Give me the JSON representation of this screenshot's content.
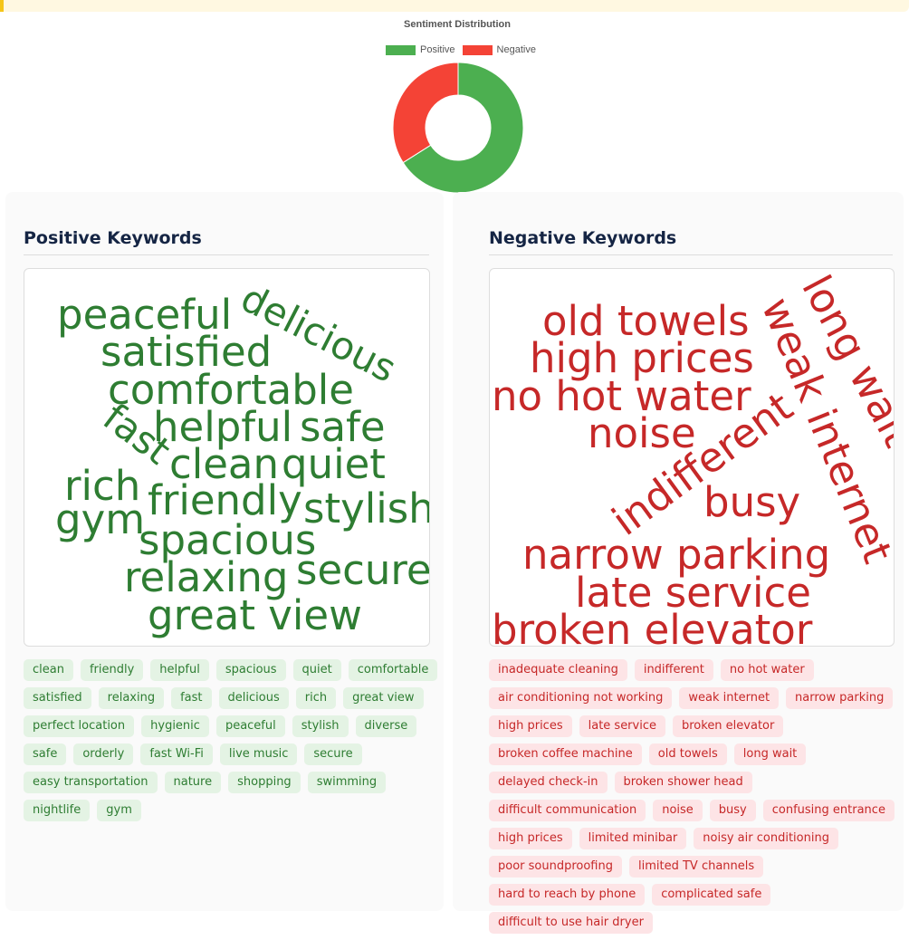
{
  "chart_data": {
    "type": "pie",
    "title": "Sentiment Distribution",
    "legend_position": "top",
    "categories": [
      "Positive",
      "Negative"
    ],
    "values": [
      66,
      34
    ],
    "colors": [
      "#4caf50",
      "#f44336"
    ]
  },
  "positive": {
    "title": "Positive Keywords",
    "color": "#2e7d32",
    "cloud": [
      "peaceful",
      "delicious",
      "satisfied",
      "comfortable",
      "helpful",
      "safe",
      "fast",
      "clean",
      "quiet",
      "rich",
      "friendly",
      "stylish",
      "gym",
      "spacious",
      "relaxing",
      "secure",
      "great view"
    ],
    "tags": [
      "clean",
      "friendly",
      "helpful",
      "spacious",
      "quiet",
      "comfortable",
      "satisfied",
      "relaxing",
      "fast",
      "delicious",
      "rich",
      "great view",
      "perfect location",
      "hygienic",
      "peaceful",
      "stylish",
      "diverse",
      "safe",
      "orderly",
      "fast Wi-Fi",
      "live music",
      "secure",
      "easy transportation",
      "nature",
      "shopping",
      "swimming",
      "nightlife",
      "gym"
    ]
  },
  "negative": {
    "title": "Negative Keywords",
    "color": "#c62828",
    "cloud": [
      "old towels",
      "long wait",
      "weak internet",
      "high prices",
      "no hot water",
      "noise",
      "indifferent",
      "busy",
      "narrow parking",
      "late service",
      "broken elevator"
    ],
    "tags": [
      "inadequate cleaning",
      "indifferent",
      "no hot water",
      "air conditioning not working",
      "weak internet",
      "narrow parking",
      "high prices",
      "late service",
      "broken elevator",
      "broken coffee machine",
      "old towels",
      "long wait",
      "delayed check-in",
      "broken shower head",
      "difficult communication",
      "noise",
      "busy",
      "confusing entrance",
      "high prices",
      "limited minibar",
      "noisy air conditioning",
      "poor soundproofing",
      "limited TV channels",
      "hard to reach by phone",
      "complicated safe",
      "difficult to use hair dryer"
    ]
  }
}
